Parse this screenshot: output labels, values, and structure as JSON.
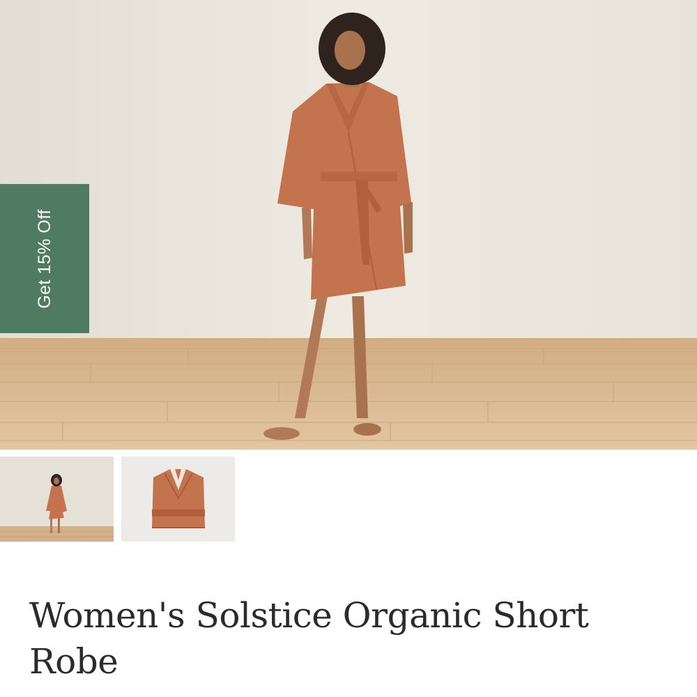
{
  "promo": {
    "label": "Get 15% Off"
  },
  "product": {
    "title": "Women's Solstice Organic Short Robe"
  },
  "gallery": {
    "main_image": "model wearing terracotta short robe",
    "thumbnails": [
      {
        "name": "thumbnail-model"
      },
      {
        "name": "thumbnail-folded-robe"
      }
    ]
  },
  "colors": {
    "robe": "#c4734f",
    "promo_bg": "#4f7b60",
    "wall": "#ebe6dd",
    "floor": "#d8b78f"
  }
}
